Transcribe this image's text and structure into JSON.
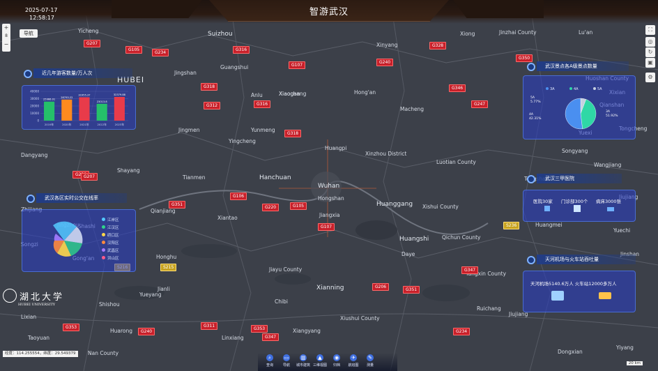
{
  "header": {
    "title": "智游武汉",
    "date": "2025-07-17",
    "time": "12:58:17"
  },
  "map_controls": {
    "nav_label": "导航",
    "zoom_in": "+",
    "zoom_level": "8",
    "zoom_out": "−",
    "coord_text": "经度：114.255554，纬度：29.549379",
    "scale": "20 km"
  },
  "places": [
    {
      "name": "HUBEI",
      "size": "huge"
    },
    {
      "name": "Suizhou",
      "size": "big"
    },
    {
      "name": "Yicheng"
    },
    {
      "name": "Jingmen"
    },
    {
      "name": "Xiaogan"
    },
    {
      "name": "Huanggang",
      "size": "big"
    },
    {
      "name": "Hanchuan",
      "size": "big"
    },
    {
      "name": "Wuhan",
      "size": "big"
    },
    {
      "name": "Hongshan"
    },
    {
      "name": "Jiangxia"
    },
    {
      "name": "Huangshi",
      "size": "big"
    },
    {
      "name": "Xianning",
      "size": "big"
    },
    {
      "name": "Chibi"
    },
    {
      "name": "Jiayu County"
    },
    {
      "name": "Xiantao"
    },
    {
      "name": "Tianmen"
    },
    {
      "name": "Qianjiang"
    },
    {
      "name": "Jingzhou"
    },
    {
      "name": "Jianli"
    },
    {
      "name": "Honghu"
    },
    {
      "name": "Shishou"
    },
    {
      "name": "Lixian"
    },
    {
      "name": "Huarong"
    },
    {
      "name": "Linxiang"
    },
    {
      "name": "Yueyang"
    },
    {
      "name": "Dangyang"
    },
    {
      "name": "Shayang"
    },
    {
      "name": "Zhijiang"
    },
    {
      "name": "Songzi"
    },
    {
      "name": "Gong'an"
    },
    {
      "name": "Shashi"
    },
    {
      "name": "Anlu"
    },
    {
      "name": "Yunmeng"
    },
    {
      "name": "Yingcheng"
    },
    {
      "name": "Xiaochang"
    },
    {
      "name": "Guangshui"
    },
    {
      "name": "Hong'an"
    },
    {
      "name": "Macheng"
    },
    {
      "name": "Xinzhou District"
    },
    {
      "name": "Huangpi"
    },
    {
      "name": "Luotian County"
    },
    {
      "name": "Xishui County"
    },
    {
      "name": "Qichun County"
    },
    {
      "name": "Daye"
    },
    {
      "name": "Yangxin County"
    },
    {
      "name": "Ruichang"
    },
    {
      "name": "Jiujiang"
    },
    {
      "name": "Xiushui County"
    },
    {
      "name": "Jinzhai County"
    },
    {
      "name": "Lu'an"
    },
    {
      "name": "Huoshan County"
    },
    {
      "name": "Qianshan"
    },
    {
      "name": "Yuexi"
    },
    {
      "name": "Wangjiang"
    },
    {
      "name": "Songyang"
    },
    {
      "name": "Tongcheng"
    },
    {
      "name": "Xixian"
    },
    {
      "name": "Huangmei"
    },
    {
      "name": "Tongshan"
    },
    {
      "name": "Jiujiang"
    },
    {
      "name": "Xinyang"
    },
    {
      "name": "Jingshan"
    },
    {
      "name": "Xiong"
    },
    {
      "name": "Yuechi"
    },
    {
      "name": "Jinshan"
    },
    {
      "name": "Nan County"
    },
    {
      "name": "Taoyuan"
    },
    {
      "name": "Dongxian"
    },
    {
      "name": "Yiyang"
    },
    {
      "name": "Xiangyang"
    }
  ],
  "roads": [
    "G207",
    "G316",
    "G234",
    "G107",
    "G318",
    "G240",
    "G346",
    "G316",
    "G318",
    "G351",
    "G106",
    "G220",
    "G105",
    "G206",
    "G347",
    "G234",
    "G328",
    "G230",
    "G312",
    "G347",
    "G105",
    "G107",
    "S236",
    "S216",
    "S215",
    "G311",
    "G353",
    "G353",
    "G207",
    "G351",
    "G240",
    "G247",
    "G350"
  ],
  "panels": {
    "tourists": {
      "title": "近几年游客数量/万人次",
      "years": [
        "2019年",
        "2020年",
        "2021年",
        "2022年",
        "2023年"
      ],
      "values": [
        25966.01,
        28793.22,
        31955.37,
        23013.8,
        32379.88
      ],
      "value_labels": [
        "25966.01",
        "28793.22",
        "31955.37",
        "23013.8",
        "32379.88"
      ],
      "y_ticks": [
        "40000",
        "30000",
        "20000",
        "10000",
        "0"
      ],
      "colors": [
        "#25c06a",
        "#ff8a1f",
        "#e83b4a",
        "#25c06a",
        "#e83b4a"
      ]
    },
    "scenic": {
      "title": "武汉景点各A级景点数量",
      "legend": [
        "3A",
        "4A",
        "5A"
      ],
      "slices": [
        {
          "label": "5A",
          "pct": "5.77%",
          "value": 5.77,
          "color": "#c6d0e0"
        },
        {
          "label": "4A",
          "pct": "42.31%",
          "value": 42.31,
          "color": "#2fd8a6"
        },
        {
          "label": "3A",
          "pct": "51.92%",
          "value": 51.92,
          "color": "#4a8ff0"
        }
      ]
    },
    "bus": {
      "title": "武汉各区实时公交在线率",
      "legend": [
        "江岸区",
        "江汉区",
        "硚口区",
        "汉阳区",
        "武昌区",
        "洪山区"
      ],
      "legend_colors": [
        "#53c9ff",
        "#2fd58a",
        "#ffd84a",
        "#ff8a3d",
        "#a67bff",
        "#ff5a8a"
      ]
    },
    "hospital": {
      "title": "武汉三甲医院",
      "items": [
        "医院30家",
        "门诊部300个",
        "病床3000张"
      ]
    },
    "traffic": {
      "title": "天河机场与火车站吞吐量",
      "text": "天河机场5140.6万人 火车站12000多万人"
    }
  },
  "toolbar": [
    {
      "label": "查询",
      "icon": "search-icon"
    },
    {
      "label": "导航",
      "icon": "navigation-icon"
    },
    {
      "label": "城市建筑",
      "icon": "building-icon"
    },
    {
      "label": "三维视图",
      "icon": "3d-view-icon"
    },
    {
      "label": "归档",
      "icon": "archive-icon"
    },
    {
      "label": "航班图",
      "icon": "flight-icon"
    },
    {
      "label": "测量",
      "icon": "measure-icon"
    }
  ],
  "logo": {
    "name": "湖北大学",
    "english": "HUBEI UNIVERSITY"
  }
}
